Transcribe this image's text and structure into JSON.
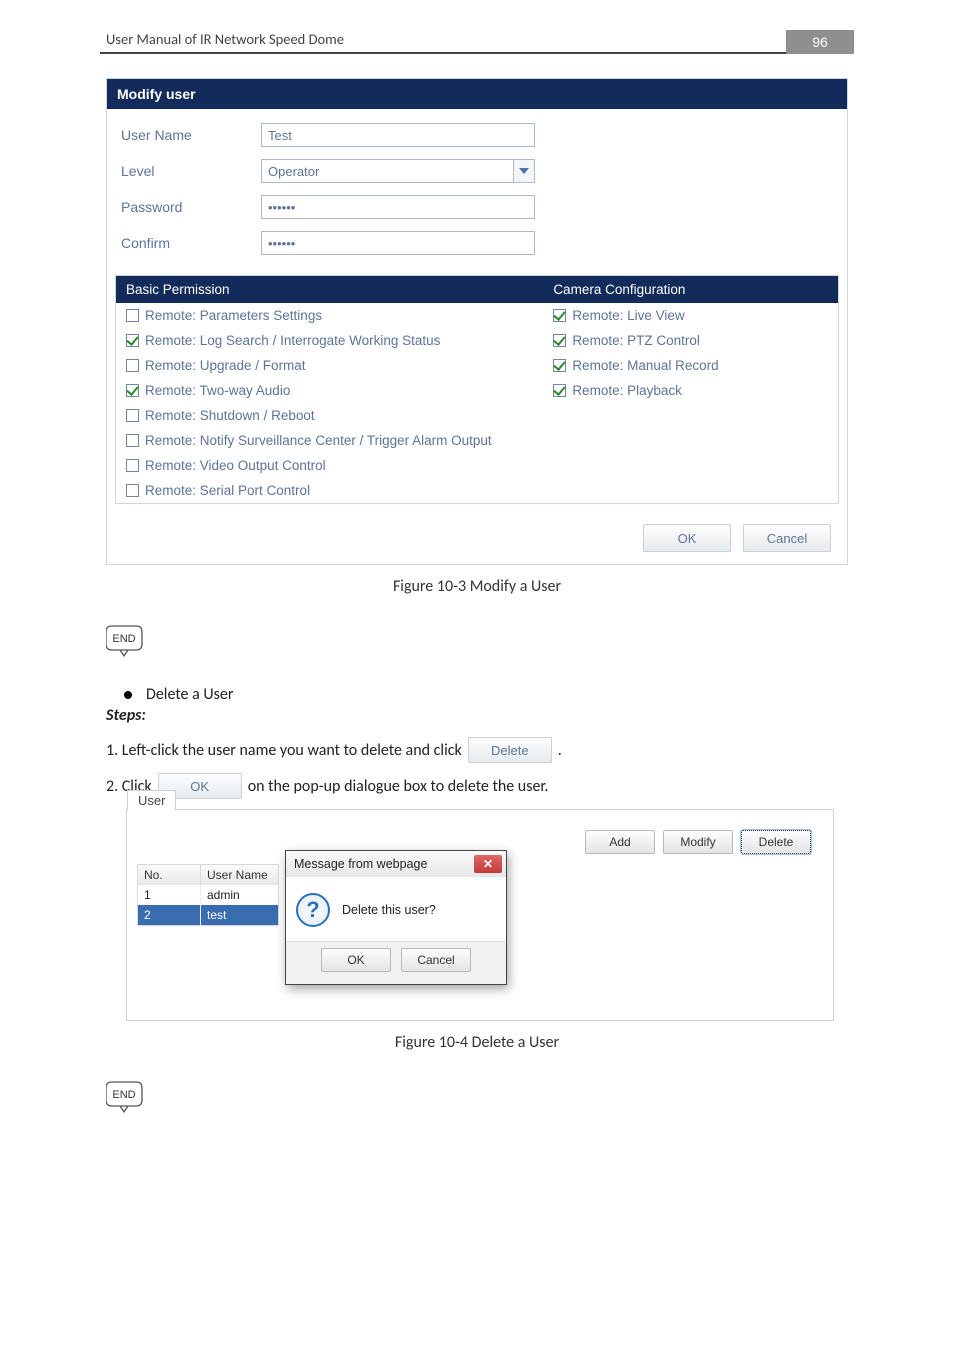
{
  "header": {
    "title": "User Manual of IR Network Speed Dome",
    "page": "96"
  },
  "modifyUser": {
    "panelTitle": "Modify user",
    "labels": {
      "userName": "User Name",
      "level": "Level",
      "password": "Password",
      "confirm": "Confirm"
    },
    "values": {
      "userName": "Test",
      "level": "Operator",
      "password": "••••••",
      "confirm": "••••••"
    },
    "basicPermissionHead": "Basic Permission",
    "cameraConfigHead": "Camera Configuration",
    "left": [
      {
        "label": "Remote: Parameters Settings",
        "checked": false
      },
      {
        "label": "Remote: Log Search / Interrogate Working Status",
        "checked": true
      },
      {
        "label": "Remote: Upgrade / Format",
        "checked": false
      },
      {
        "label": "Remote: Two-way Audio",
        "checked": true
      },
      {
        "label": "Remote: Shutdown / Reboot",
        "checked": false
      },
      {
        "label": "Remote: Notify Surveillance Center / Trigger Alarm Output",
        "checked": false
      },
      {
        "label": "Remote: Video Output Control",
        "checked": false
      },
      {
        "label": "Remote: Serial Port Control",
        "checked": false
      }
    ],
    "right": [
      {
        "label": "Remote: Live View",
        "checked": true
      },
      {
        "label": "Remote: PTZ Control",
        "checked": true
      },
      {
        "label": "Remote: Manual Record",
        "checked": true
      },
      {
        "label": "Remote: Playback",
        "checked": true
      }
    ],
    "ok": "OK",
    "cancel": "Cancel"
  },
  "captions": {
    "fig103": "Figure 10-3 Modify a User",
    "fig104": "Figure 10-4 Delete a User"
  },
  "section": {
    "bullet": "Delete a User",
    "stepsTitle": "Steps:",
    "step1a": "1.  Left-click the user name you want to delete and click",
    "step1bBtn": "Delete",
    "step1c": ".",
    "step2a": "2.  Click",
    "step2bBtn": "OK",
    "step2c": "on the pop-up dialogue box to delete the user."
  },
  "userPanel": {
    "tab": "User",
    "buttons": {
      "add": "Add",
      "modify": "Modify",
      "delete": "Delete"
    },
    "cols": {
      "no": "No.",
      "userName": "User Name"
    },
    "rows": [
      {
        "no": "1",
        "name": "admin",
        "selected": false
      },
      {
        "no": "2",
        "name": "test",
        "selected": true
      }
    ],
    "dialog": {
      "title": "Message from webpage",
      "body": "Delete this user?",
      "ok": "OK",
      "cancel": "Cancel"
    }
  },
  "endBadge": "END"
}
